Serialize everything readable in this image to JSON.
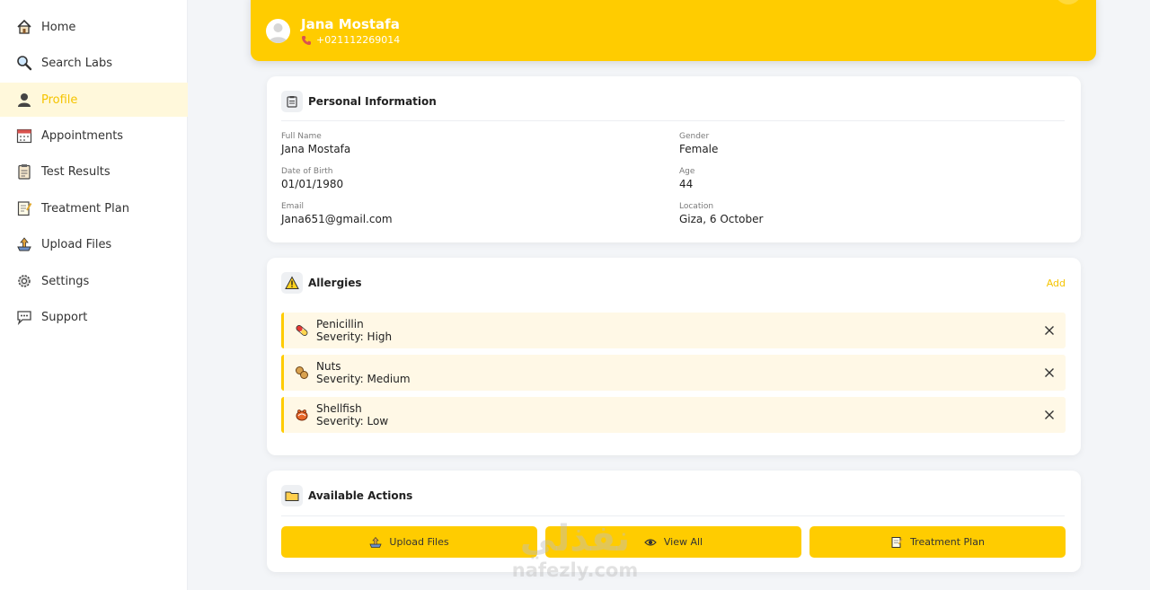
{
  "sidebar": {
    "items": [
      {
        "label": "Home",
        "icon": "home-icon"
      },
      {
        "label": "Search Labs",
        "icon": "search-icon"
      },
      {
        "label": "Profile",
        "icon": "user-icon",
        "active": true
      },
      {
        "label": "Appointments",
        "icon": "calendar-icon"
      },
      {
        "label": "Test Results",
        "icon": "clipboard-icon"
      },
      {
        "label": "Treatment Plan",
        "icon": "memo-icon"
      },
      {
        "label": "Upload Files",
        "icon": "upload-icon"
      },
      {
        "label": "Settings",
        "icon": "gear-icon"
      },
      {
        "label": "Support",
        "icon": "chat-icon"
      }
    ]
  },
  "header": {
    "name": "Jana Mostafa",
    "phone": "+021112269014"
  },
  "personal": {
    "title": "Personal Information",
    "full_name_label": "Full Name",
    "full_name": "Jana Mostafa",
    "gender_label": "Gender",
    "gender": "Female",
    "dob_label": "Date of Birth",
    "dob": "01/01/1980",
    "age_label": "Age",
    "age": "44",
    "email_label": "Email",
    "email": "Jana651@gmail.com",
    "location_label": "Location",
    "location": "Giza, 6 October"
  },
  "allergies": {
    "title": "Allergies",
    "add_label": "Add",
    "items": [
      {
        "name": "Penicillin",
        "severity": "Severity: High",
        "icon": "pill-icon"
      },
      {
        "name": "Nuts",
        "severity": "Severity: Medium",
        "icon": "peanut-icon"
      },
      {
        "name": "Shellfish",
        "severity": "Severity: Low",
        "icon": "shellfish-icon"
      }
    ]
  },
  "actions": {
    "title": "Available Actions",
    "buttons": [
      {
        "label": "Upload Files",
        "icon": "upload-icon"
      },
      {
        "label": "View All",
        "icon": "eye-icon"
      },
      {
        "label": "Treatment Plan",
        "icon": "memo-icon"
      }
    ]
  },
  "watermark": {
    "arabic": "نفذلي",
    "latin": "nafezly.com"
  },
  "colors": {
    "accent": "#ffcc00",
    "accent_text": "#f5c400",
    "allergy_bg": "#fff8e6",
    "page_bg": "#f3f5f8"
  }
}
